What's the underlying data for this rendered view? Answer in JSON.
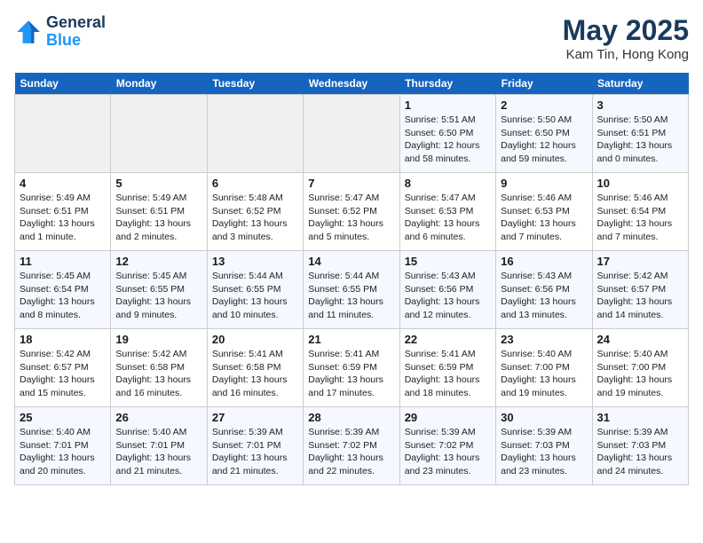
{
  "header": {
    "logo_line1": "General",
    "logo_line2": "Blue",
    "month": "May 2025",
    "location": "Kam Tin, Hong Kong"
  },
  "weekdays": [
    "Sunday",
    "Monday",
    "Tuesday",
    "Wednesday",
    "Thursday",
    "Friday",
    "Saturday"
  ],
  "weeks": [
    [
      {
        "day": "",
        "info": ""
      },
      {
        "day": "",
        "info": ""
      },
      {
        "day": "",
        "info": ""
      },
      {
        "day": "",
        "info": ""
      },
      {
        "day": "1",
        "info": "Sunrise: 5:51 AM\nSunset: 6:50 PM\nDaylight: 12 hours\nand 58 minutes."
      },
      {
        "day": "2",
        "info": "Sunrise: 5:50 AM\nSunset: 6:50 PM\nDaylight: 12 hours\nand 59 minutes."
      },
      {
        "day": "3",
        "info": "Sunrise: 5:50 AM\nSunset: 6:51 PM\nDaylight: 13 hours\nand 0 minutes."
      }
    ],
    [
      {
        "day": "4",
        "info": "Sunrise: 5:49 AM\nSunset: 6:51 PM\nDaylight: 13 hours\nand 1 minute."
      },
      {
        "day": "5",
        "info": "Sunrise: 5:49 AM\nSunset: 6:51 PM\nDaylight: 13 hours\nand 2 minutes."
      },
      {
        "day": "6",
        "info": "Sunrise: 5:48 AM\nSunset: 6:52 PM\nDaylight: 13 hours\nand 3 minutes."
      },
      {
        "day": "7",
        "info": "Sunrise: 5:47 AM\nSunset: 6:52 PM\nDaylight: 13 hours\nand 5 minutes."
      },
      {
        "day": "8",
        "info": "Sunrise: 5:47 AM\nSunset: 6:53 PM\nDaylight: 13 hours\nand 6 minutes."
      },
      {
        "day": "9",
        "info": "Sunrise: 5:46 AM\nSunset: 6:53 PM\nDaylight: 13 hours\nand 7 minutes."
      },
      {
        "day": "10",
        "info": "Sunrise: 5:46 AM\nSunset: 6:54 PM\nDaylight: 13 hours\nand 7 minutes."
      }
    ],
    [
      {
        "day": "11",
        "info": "Sunrise: 5:45 AM\nSunset: 6:54 PM\nDaylight: 13 hours\nand 8 minutes."
      },
      {
        "day": "12",
        "info": "Sunrise: 5:45 AM\nSunset: 6:55 PM\nDaylight: 13 hours\nand 9 minutes."
      },
      {
        "day": "13",
        "info": "Sunrise: 5:44 AM\nSunset: 6:55 PM\nDaylight: 13 hours\nand 10 minutes."
      },
      {
        "day": "14",
        "info": "Sunrise: 5:44 AM\nSunset: 6:55 PM\nDaylight: 13 hours\nand 11 minutes."
      },
      {
        "day": "15",
        "info": "Sunrise: 5:43 AM\nSunset: 6:56 PM\nDaylight: 13 hours\nand 12 minutes."
      },
      {
        "day": "16",
        "info": "Sunrise: 5:43 AM\nSunset: 6:56 PM\nDaylight: 13 hours\nand 13 minutes."
      },
      {
        "day": "17",
        "info": "Sunrise: 5:42 AM\nSunset: 6:57 PM\nDaylight: 13 hours\nand 14 minutes."
      }
    ],
    [
      {
        "day": "18",
        "info": "Sunrise: 5:42 AM\nSunset: 6:57 PM\nDaylight: 13 hours\nand 15 minutes."
      },
      {
        "day": "19",
        "info": "Sunrise: 5:42 AM\nSunset: 6:58 PM\nDaylight: 13 hours\nand 16 minutes."
      },
      {
        "day": "20",
        "info": "Sunrise: 5:41 AM\nSunset: 6:58 PM\nDaylight: 13 hours\nand 16 minutes."
      },
      {
        "day": "21",
        "info": "Sunrise: 5:41 AM\nSunset: 6:59 PM\nDaylight: 13 hours\nand 17 minutes."
      },
      {
        "day": "22",
        "info": "Sunrise: 5:41 AM\nSunset: 6:59 PM\nDaylight: 13 hours\nand 18 minutes."
      },
      {
        "day": "23",
        "info": "Sunrise: 5:40 AM\nSunset: 7:00 PM\nDaylight: 13 hours\nand 19 minutes."
      },
      {
        "day": "24",
        "info": "Sunrise: 5:40 AM\nSunset: 7:00 PM\nDaylight: 13 hours\nand 19 minutes."
      }
    ],
    [
      {
        "day": "25",
        "info": "Sunrise: 5:40 AM\nSunset: 7:01 PM\nDaylight: 13 hours\nand 20 minutes."
      },
      {
        "day": "26",
        "info": "Sunrise: 5:40 AM\nSunset: 7:01 PM\nDaylight: 13 hours\nand 21 minutes."
      },
      {
        "day": "27",
        "info": "Sunrise: 5:39 AM\nSunset: 7:01 PM\nDaylight: 13 hours\nand 21 minutes."
      },
      {
        "day": "28",
        "info": "Sunrise: 5:39 AM\nSunset: 7:02 PM\nDaylight: 13 hours\nand 22 minutes."
      },
      {
        "day": "29",
        "info": "Sunrise: 5:39 AM\nSunset: 7:02 PM\nDaylight: 13 hours\nand 23 minutes."
      },
      {
        "day": "30",
        "info": "Sunrise: 5:39 AM\nSunset: 7:03 PM\nDaylight: 13 hours\nand 23 minutes."
      },
      {
        "day": "31",
        "info": "Sunrise: 5:39 AM\nSunset: 7:03 PM\nDaylight: 13 hours\nand 24 minutes."
      }
    ]
  ]
}
